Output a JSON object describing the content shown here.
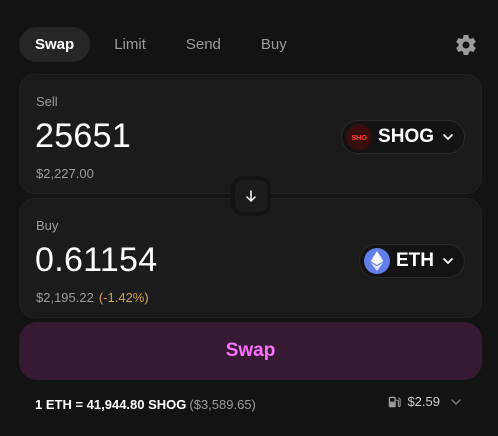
{
  "tabs": [
    {
      "label": "Swap",
      "active": true
    },
    {
      "label": "Limit",
      "active": false
    },
    {
      "label": "Send",
      "active": false
    },
    {
      "label": "Buy",
      "active": false
    }
  ],
  "sell": {
    "label": "Sell",
    "amount": "25651",
    "usd": "$2,227.00",
    "token": {
      "symbol": "SHOG",
      "logo_text": "SHO"
    }
  },
  "buy": {
    "label": "Buy",
    "amount": "0.61154",
    "usd": "$2,195.22",
    "pct": "(-1.42%)",
    "token": {
      "symbol": "ETH"
    }
  },
  "swap_button": "Swap",
  "rate": {
    "text": "1 ETH = 41,944.80 SHOG",
    "usd": "($3,589.65)"
  },
  "gas": {
    "value": "$2.59"
  },
  "icons": {
    "settings": "gear-icon",
    "switch": "arrow-down-icon",
    "chevron": "chevron-down-icon",
    "gas": "gas-pump-icon",
    "eth_logo": "ethereum-icon"
  },
  "colors": {
    "background": "#131313",
    "panel": "#1b1b1b",
    "accent": "#fc72ff",
    "swap_button_bg": "#361a33",
    "negative_pct": "#d6a24d"
  }
}
